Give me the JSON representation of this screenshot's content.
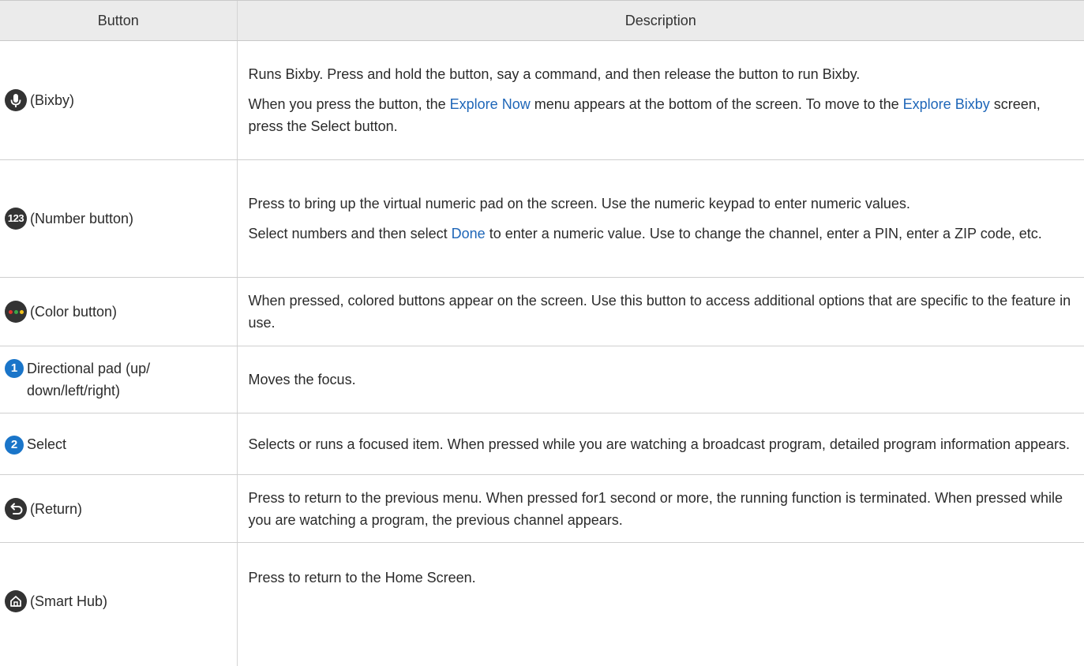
{
  "header": {
    "button": "Button",
    "description": "Description"
  },
  "rows": [
    {
      "icon": "microphone-icon",
      "label": "(Bixby)",
      "desc": [
        {
          "parts": [
            "Runs Bixby. Press and hold the button, say a command, and then release the button to run Bixby."
          ]
        },
        {
          "parts": [
            "When you press the button, the ",
            "Explore Now",
            " menu appears at the bottom of the screen. To move to the ",
            "Explore Bixby",
            " screen, press the Select button."
          ]
        }
      ]
    },
    {
      "icon": "number-123-icon",
      "icon_text": "123",
      "label": "(Number button)",
      "desc": [
        {
          "parts": [
            "Press to bring up the virtual numeric pad on the screen. Use the numeric keypad to enter numeric values."
          ]
        },
        {
          "parts": [
            "Select numbers and then select ",
            "Done",
            " to enter a numeric value. Use to change the channel, enter a PIN, enter a ZIP code, etc."
          ]
        }
      ]
    },
    {
      "icon": "color-dots-icon",
      "label": "(Color button)",
      "desc": [
        {
          "parts": [
            "When pressed, colored buttons appear on the screen. Use this button to access additional options that are specific to the feature in use."
          ]
        }
      ]
    },
    {
      "icon": "callout-1-icon",
      "icon_text": "1",
      "label": "Directional pad (up/ down/left/right)",
      "desc": [
        {
          "parts": [
            "Moves the focus."
          ]
        }
      ]
    },
    {
      "icon": "callout-2-icon",
      "icon_text": "2",
      "label": "Select",
      "desc": [
        {
          "parts": [
            "Selects or runs a focused item. When pressed while you are watching a broadcast program, detailed program information appears."
          ]
        }
      ]
    },
    {
      "icon": "return-arrow-icon",
      "label": "(Return)",
      "desc": [
        {
          "parts": [
            "Press to return to the previous menu. When pressed for1 second or more, the running function is terminated. When pressed while you are watching a program, the previous channel appears."
          ]
        }
      ]
    },
    {
      "icon": "home-icon",
      "label": "(Smart Hub)",
      "desc": [
        {
          "parts": [
            "Press to return to the Home Screen."
          ]
        }
      ]
    }
  ],
  "colors": {
    "highlight": "#1e66b8",
    "icon_dark": "#333333",
    "icon_blue": "#1a75c9",
    "dot_red": "#e0352b",
    "dot_yellow": "#f2c21b",
    "dot_green": "#3aa84a"
  }
}
